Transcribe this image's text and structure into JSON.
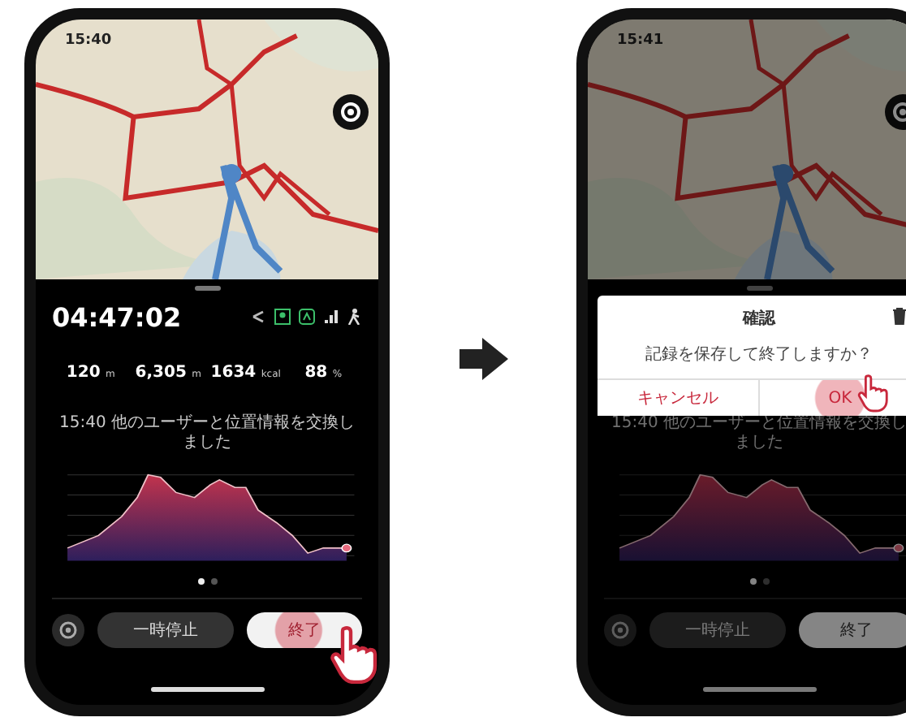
{
  "phones": [
    {
      "dimmed": false,
      "status_time": "15:40",
      "elapsed": "04:47:02",
      "stats": [
        {
          "value": "120",
          "unit": "m"
        },
        {
          "value": "6,305",
          "unit": "m"
        },
        {
          "value": "1634",
          "unit": "kcal"
        },
        {
          "value": "88",
          "unit": "%"
        }
      ],
      "notice": "15:40 他のユーザーと位置情報を交換しました",
      "page_dots": [
        {
          "selected": true
        },
        {
          "selected": false
        }
      ],
      "pause_button": "一時停止",
      "finish_button": {
        "label": "終了",
        "tapped": true
      }
    },
    {
      "dimmed": true,
      "status_time": "15:41",
      "notice": "15:40 他のユーザーと位置情報を交換しました",
      "page_dots": [
        {
          "selected": true
        },
        {
          "selected": false
        }
      ],
      "pause_button": "一時停止",
      "finish_button": {
        "label": "終了",
        "tapped": false
      },
      "dialog": {
        "title": "確認",
        "message": "記録を保存して終了しますか？",
        "buttons": [
          {
            "label": "キャンセル",
            "tapped": false
          },
          {
            "label": "OK",
            "tapped": true
          }
        ]
      }
    }
  ]
}
